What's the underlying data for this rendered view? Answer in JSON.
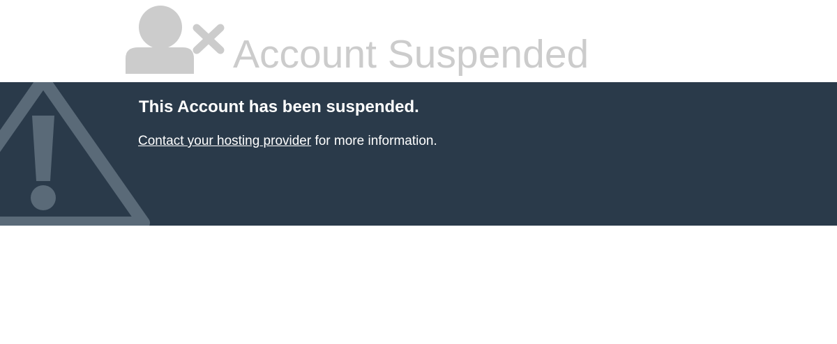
{
  "header": {
    "title": "Account Suspended",
    "icon": "user-x-icon"
  },
  "notice": {
    "headline": "This Account has been suspended.",
    "link_text": "Contact your hosting provider",
    "suffix_text": " for more information.",
    "background_icon": "warning-icon"
  },
  "colors": {
    "band_background": "#2a3a4a",
    "title_gray": "#cccccc",
    "icon_gray": "#cccccc",
    "warning_icon": "#5a6a78",
    "text": "#ffffff"
  }
}
